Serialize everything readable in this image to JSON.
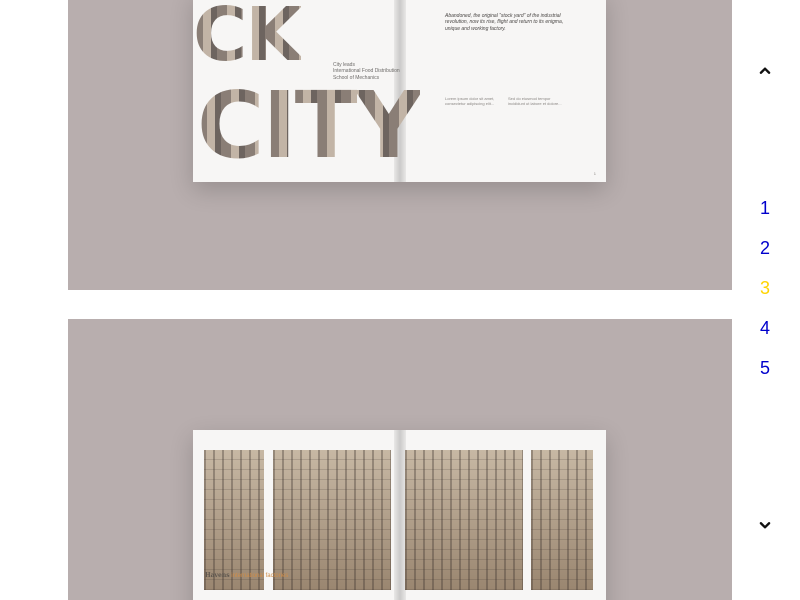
{
  "gallery": {
    "slides": [
      {
        "title_letters_1": "CK",
        "title_letters_2": "CITY",
        "top_italic_excerpt": "Abandoned, the original “stock yard” of the industrial revolution, now its rise, flight and return to its enigma, unique and working factory.",
        "credit_block": "City leads\nInternational Food Distribution\nSchool of Mechanics",
        "col1_text": "Lorem ipsum dolor sit amet, consectetur adipiscing elit...",
        "col2_text": "Sed do eiusmod tempor incididunt ut labore et dolore...",
        "page_number": "1"
      },
      {
        "heading_snippet_title": "Havens",
        "heading_snippet_subtitle": "international factories",
        "page_number": ""
      }
    ]
  },
  "navigation": {
    "pages": [
      "1",
      "2",
      "3",
      "4",
      "5"
    ],
    "active_page": "3",
    "up_icon": "chevron-up-icon",
    "down_icon": "chevron-down-icon",
    "colors": {
      "link": "#0000cc",
      "active": "#ffd400",
      "background": "#b8aeae"
    }
  }
}
